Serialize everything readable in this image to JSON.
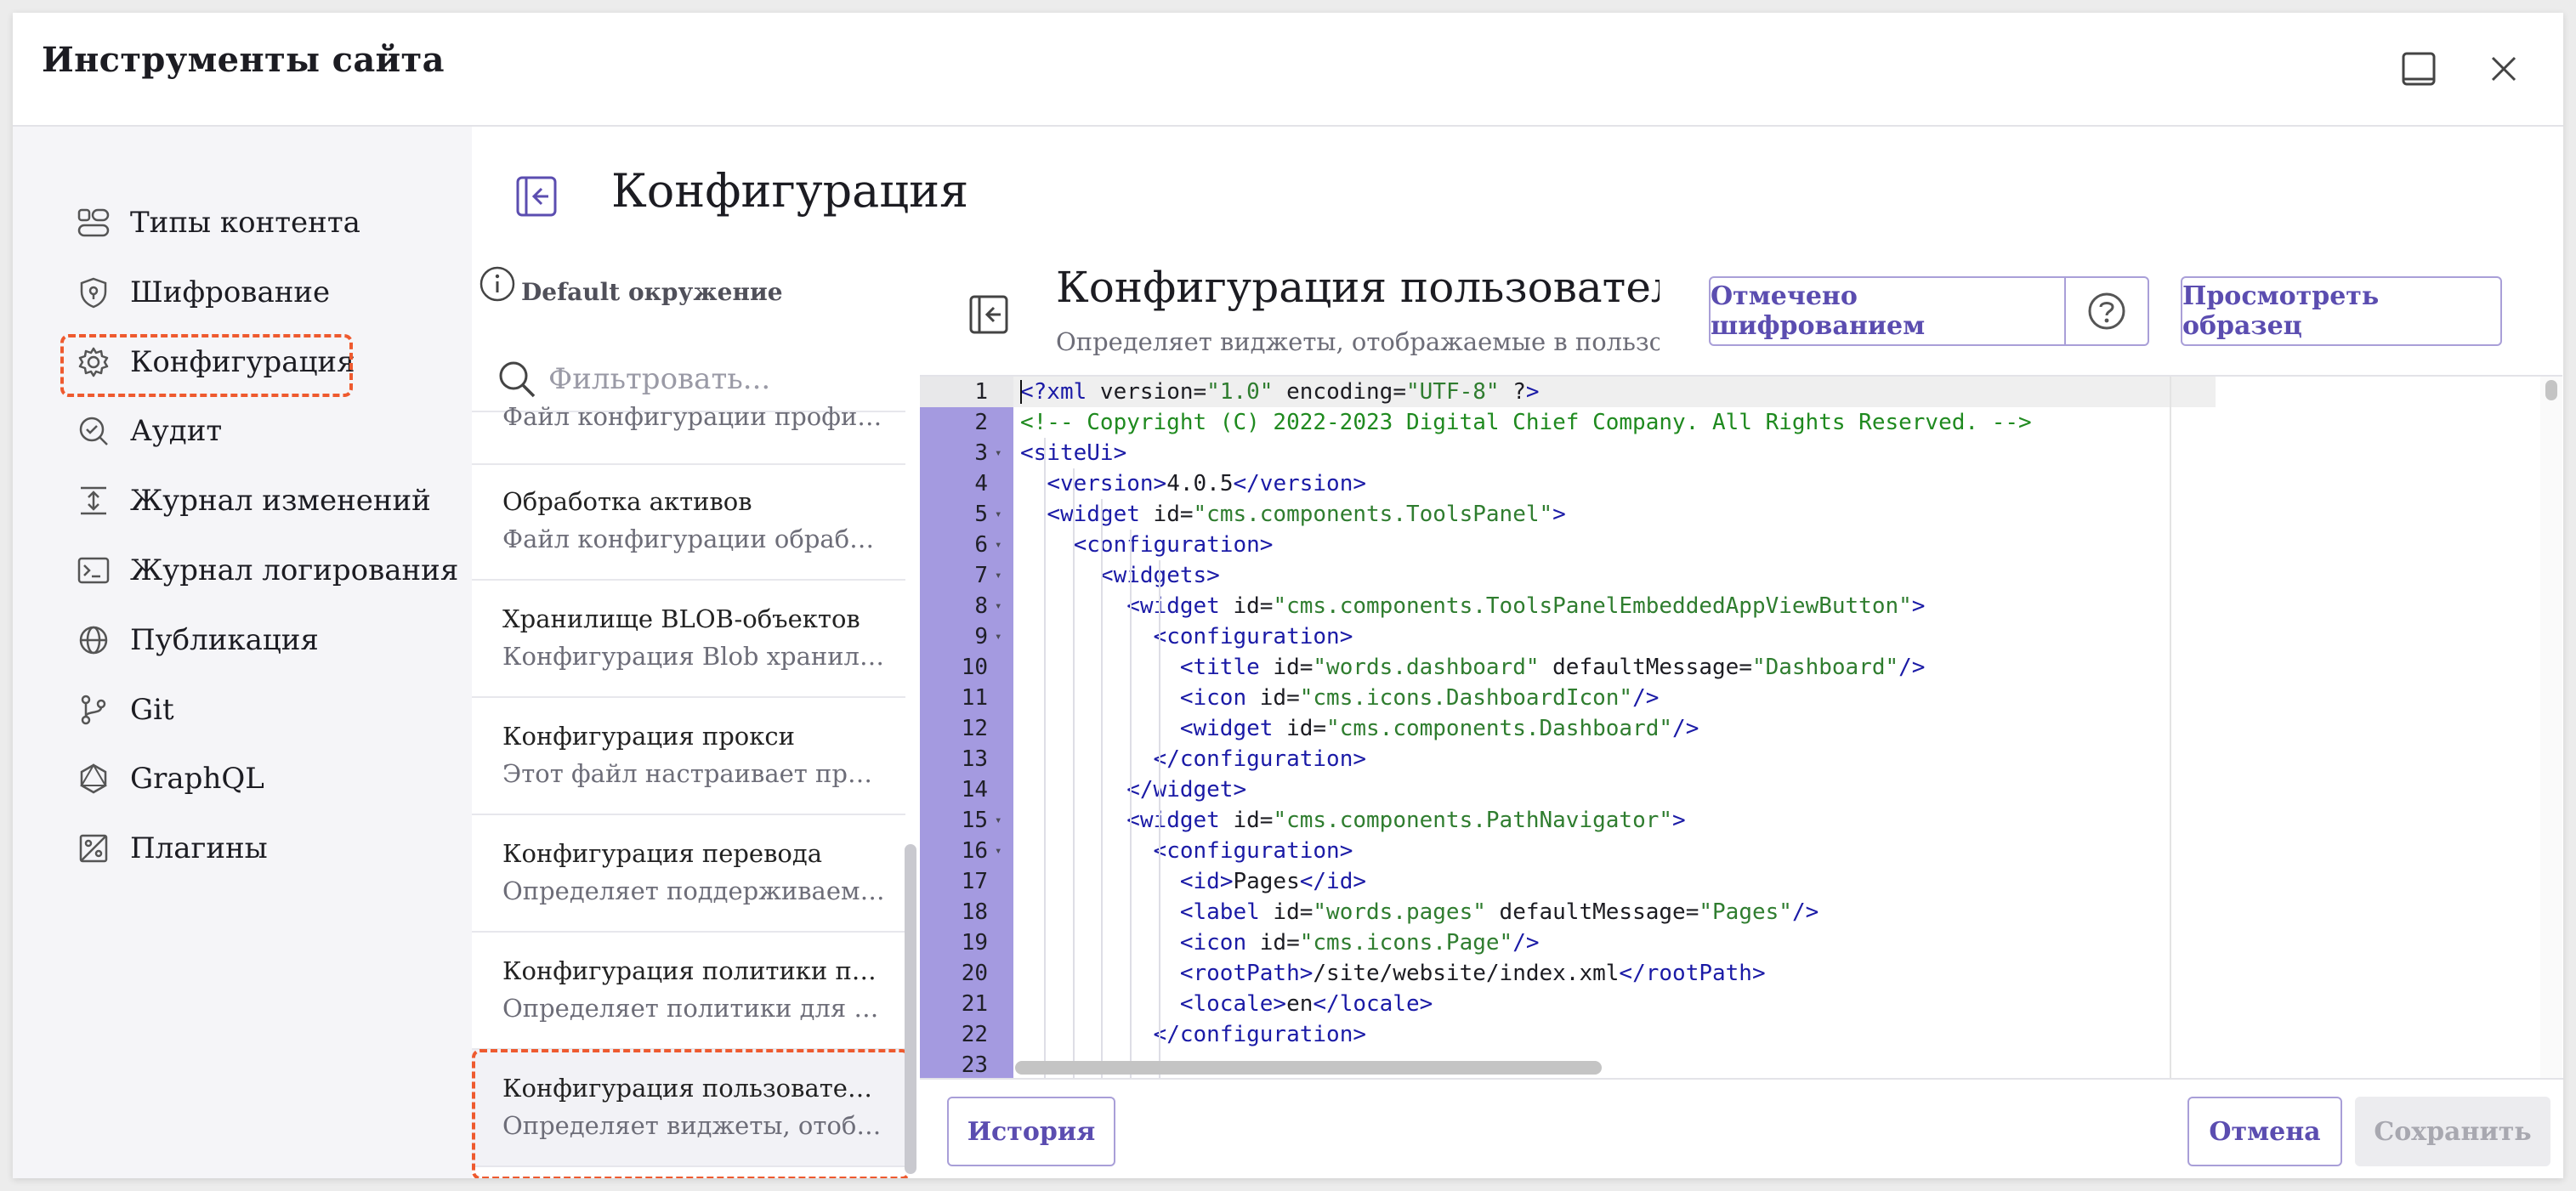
{
  "window": {
    "title": "Инструменты сайта",
    "minimize_icon": "minimize-icon",
    "close_icon": "close-icon"
  },
  "sidebar": {
    "items": [
      {
        "label": "Типы контента",
        "icon": "content-types-icon"
      },
      {
        "label": "Шифрование",
        "icon": "shield-icon"
      },
      {
        "label": "Конфигурация",
        "icon": "gear-icon"
      },
      {
        "label": "Аудит",
        "icon": "audit-icon"
      },
      {
        "label": "Журнал изменений",
        "icon": "history-icon"
      },
      {
        "label": "Журнал логирования",
        "icon": "terminal-icon"
      },
      {
        "label": "Публикация",
        "icon": "globe-icon"
      },
      {
        "label": "Git",
        "icon": "git-branch-icon"
      },
      {
        "label": "GraphQL",
        "icon": "graphql-icon"
      },
      {
        "label": "Плагины",
        "icon": "plugin-icon"
      }
    ],
    "selected": "Конфигурация"
  },
  "main": {
    "title": "Конфигурация"
  },
  "list": {
    "environment": "Default окружение",
    "filter_placeholder": "Фильтровать...",
    "partial_top": "Файл конфигурации профиле...",
    "items": [
      {
        "title": "Обработка активов",
        "desc": "Файл конфигурации обработки активов"
      },
      {
        "title": "Хранилище BLOB-объектов",
        "desc": "Конфигурация Blob хранилища"
      },
      {
        "title": "Конфигурация прокси",
        "desc": "Этот файл настраивает прокси-серверы"
      },
      {
        "title": "Конфигурация перевода",
        "desc": "Определяет поддерживаемые языки"
      },
      {
        "title": "Конфигурация политики проекта",
        "desc": "Определяет политики для проекта"
      },
      {
        "title": "Конфигурация пользовательского интерфейса",
        "desc": "Определяет виджеты, отображаемые в пользовательском интерфейсе"
      }
    ]
  },
  "editor": {
    "title": "Конфигурация пользовательского интерфейса",
    "description": "Определяет виджеты, отображаемые в пользовательском интерфейсе",
    "encrypted_label": "Отмечено шифрованием",
    "help_icon": "help-icon",
    "view_sample_label": "Просмотреть образец",
    "history_label": "История",
    "cancel_label": "Отмена",
    "save_label": "Сохранить"
  },
  "code_lines": [
    "<?xml version=\"1.0\" encoding=\"UTF-8\" ?>",
    "<!-- Copyright (C) 2022-2023 Digital Chief Company. All Rights Reserved. -->",
    "<siteUi>",
    "  <version>4.0.5</version>",
    "  <widget id=\"cms.components.ToolsPanel\">",
    "    <configuration>",
    "      <widgets>",
    "        <widget id=\"cms.components.ToolsPanelEmbeddedAppViewButton\">",
    "          <configuration>",
    "            <title id=\"words.dashboard\" defaultMessage=\"Dashboard\"/>",
    "            <icon id=\"cms.icons.DashboardIcon\"/>",
    "            <widget id=\"cms.components.Dashboard\"/>",
    "          </configuration>",
    "        </widget>",
    "        <widget id=\"cms.components.PathNavigator\">",
    "          <configuration>",
    "            <id>Pages</id>",
    "            <label id=\"words.pages\" defaultMessage=\"Pages\"/>",
    "            <icon id=\"cms.icons.Page\"/>",
    "            <rootPath>/site/website/index.xml</rootPath>",
    "            <locale>en</locale>",
    "          </configuration>",
    ""
  ],
  "fold_lines": [
    3,
    5,
    6,
    7,
    8,
    9,
    15,
    16
  ]
}
